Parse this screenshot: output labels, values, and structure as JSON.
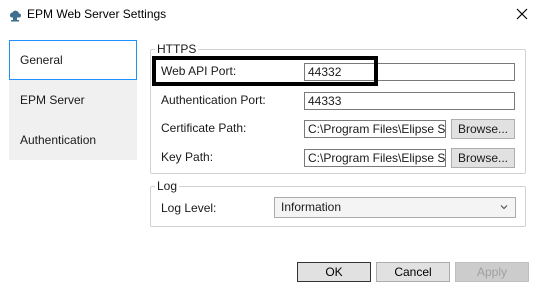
{
  "window": {
    "title": "EPM Web Server Settings"
  },
  "sidebar": {
    "items": [
      {
        "label": "General",
        "selected": true
      },
      {
        "label": "EPM Server",
        "selected": false
      },
      {
        "label": "Authentication",
        "selected": false
      }
    ]
  },
  "https": {
    "legend": "HTTPS",
    "web_api_port": {
      "label": "Web API Port:",
      "value": "44332"
    },
    "authentication_port": {
      "label": "Authentication Port:",
      "value": "44333"
    },
    "certificate_path": {
      "label": "Certificate Path:",
      "value": "C:\\Program Files\\Elipse So",
      "browse_label": "Browse..."
    },
    "key_path": {
      "label": "Key Path:",
      "value": "C:\\Program Files\\Elipse So",
      "browse_label": "Browse..."
    }
  },
  "log": {
    "legend": "Log",
    "level_label": "Log Level:",
    "level_value": "Information"
  },
  "footer": {
    "ok_label": "OK",
    "cancel_label": "Cancel",
    "apply_label": "Apply"
  },
  "colors": {
    "selection_border": "#1e90ff",
    "sidebar_bg": "#f0f0f0",
    "highlight": "#000000"
  },
  "icons": {
    "app": "cloud-server-icon",
    "close": "close-icon",
    "dropdown": "chevron-down-icon"
  }
}
